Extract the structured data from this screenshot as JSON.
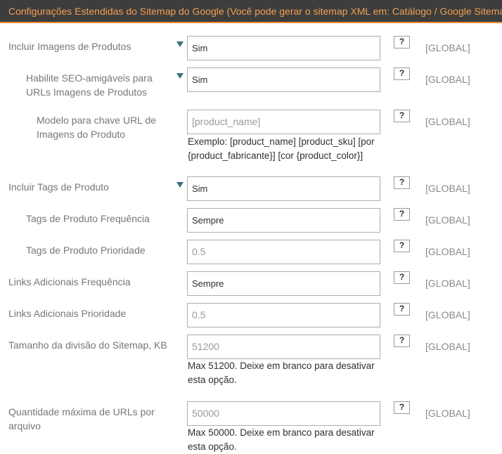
{
  "header": {
    "title": "Configurações Estendidas do Sitemap do Google (Você pode gerar o sitemap XML em: Catálogo / Google Sitemap)"
  },
  "rows": [
    {
      "label": "Incluir Imagens de Produtos",
      "value": "Sim",
      "type": "select",
      "help": "?",
      "scope": "[GLOBAL]"
    },
    {
      "label": "Habilite SEO-amigáveis para URLs Imagens de Produtos",
      "value": "Sim",
      "type": "select",
      "help": "?",
      "scope": "[GLOBAL]"
    },
    {
      "label": "Modelo para chave URL de Imagens do Produto",
      "value": "[product_name]",
      "type": "text",
      "note": "Exemplo: [product_name] [product_sku] [por {product_fabricante}] [cor {product_color}]",
      "help": "?",
      "scope": "[GLOBAL]"
    },
    {
      "label": "Incluir Tags de Produto",
      "value": "Sim",
      "type": "select",
      "help": "?",
      "scope": "[GLOBAL]"
    },
    {
      "label": "Tags de Produto Frequência",
      "value": "Sempre",
      "type": "select",
      "help": "?",
      "scope": "[GLOBAL]"
    },
    {
      "label": "Tags de Produto Prioridade",
      "value": "0.5",
      "type": "text",
      "help": "?",
      "scope": "[GLOBAL]"
    },
    {
      "label": "Links Adicionais Frequência",
      "value": "Sempre",
      "type": "select",
      "help": "?",
      "scope": "[GLOBAL]"
    },
    {
      "label": "Links Adicionais Prioridade",
      "value": "0.5",
      "type": "text",
      "help": "?",
      "scope": "[GLOBAL]"
    },
    {
      "label": "Tamanho da divisão do Sitemap, KB",
      "value": "51200",
      "type": "text",
      "note": "Max 51200. Deixe em branco para desativar esta opção.",
      "help": "?",
      "scope": "[GLOBAL]"
    },
    {
      "label": "Quantidade máxima de URLs por arquivo",
      "value": "50000",
      "type": "text",
      "note": "Max 50000. Deixe em branco para desativar esta opção.",
      "help": "?",
      "scope": "[GLOBAL]"
    }
  ]
}
